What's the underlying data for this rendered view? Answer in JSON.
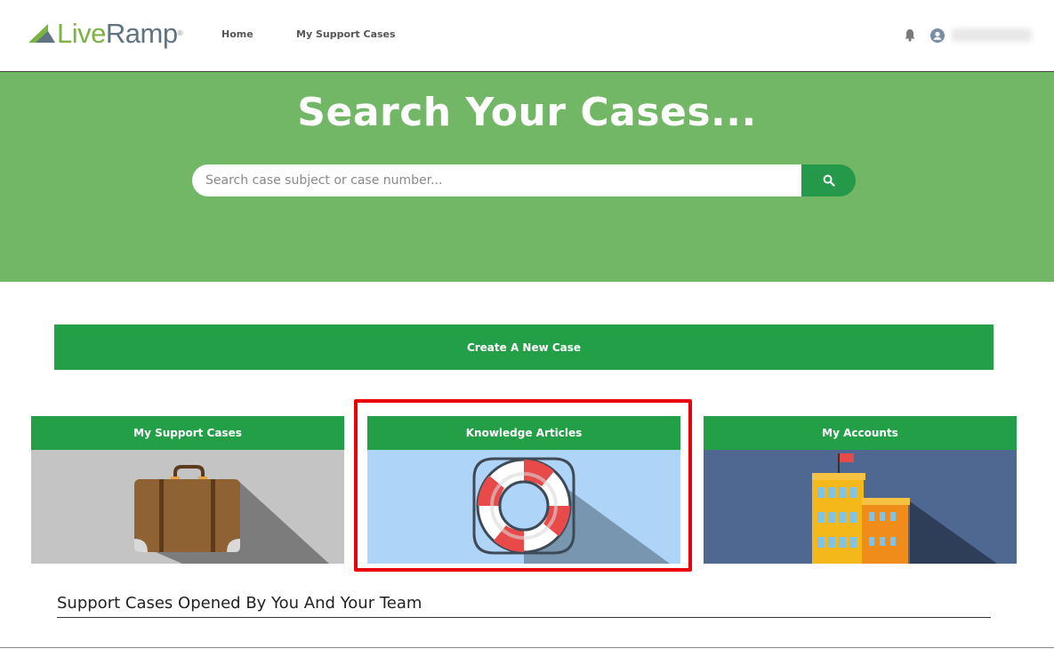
{
  "header": {
    "logo": {
      "part1": "Live",
      "part2": "Ramp",
      "tm": "®"
    },
    "nav": [
      {
        "label": "Home"
      },
      {
        "label": "My Support Cases"
      }
    ],
    "notifications_icon": "bell-icon",
    "user_icon": "user-avatar-icon"
  },
  "hero": {
    "title": "Search Your Cases...",
    "search": {
      "placeholder": "Search case subject or case number...",
      "value": "",
      "button_icon": "search-icon"
    },
    "background_color": "#72b766"
  },
  "create_case": {
    "label": "Create A New Case"
  },
  "tiles": [
    {
      "label": "My Support Cases",
      "icon": "suitcase-icon",
      "bg": "#c4c4c4"
    },
    {
      "label": "Knowledge Articles",
      "icon": "life-ring-icon",
      "bg": "#aed4f8",
      "highlighted": true
    },
    {
      "label": "My Accounts",
      "icon": "building-icon",
      "bg": "#4f6891"
    }
  ],
  "section": {
    "title": "Support Cases Opened By You And Your Team"
  },
  "colors": {
    "accent": "#23a047",
    "highlight": "#e8000b"
  }
}
